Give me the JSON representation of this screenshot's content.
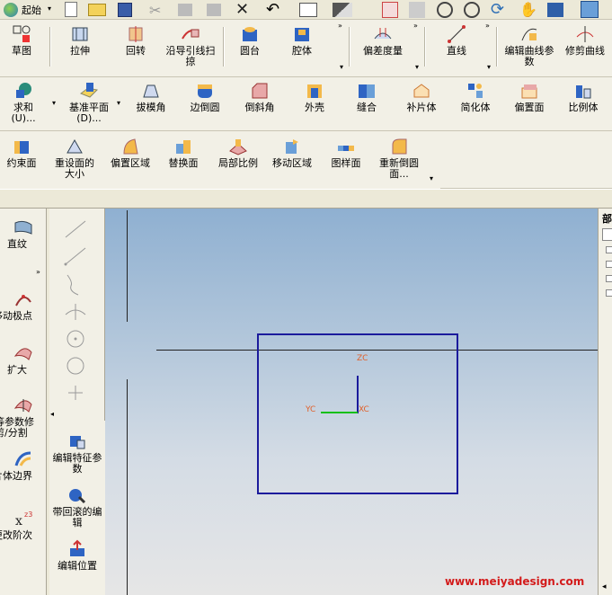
{
  "top_toolbar": {
    "start_label": "起始"
  },
  "row1": [
    {
      "label": "草图"
    },
    {
      "label": "拉伸"
    },
    {
      "label": "回转"
    },
    {
      "label": "沿导引线扫掠"
    },
    {
      "label": "圆台"
    },
    {
      "label": "腔体"
    },
    {
      "label": "偏差度量"
    },
    {
      "label": "直线"
    },
    {
      "label": "编辑曲线参数"
    },
    {
      "label": "修剪曲线"
    }
  ],
  "row2": [
    {
      "label": "求和(U)..."
    },
    {
      "label": "基准平面(D)..."
    },
    {
      "label": "拔模角"
    },
    {
      "label": "边倒圆"
    },
    {
      "label": "倒斜角"
    },
    {
      "label": "外壳"
    },
    {
      "label": "缝合"
    },
    {
      "label": "补片体"
    },
    {
      "label": "简化体"
    },
    {
      "label": "偏置面"
    },
    {
      "label": "比例体"
    }
  ],
  "row3": [
    {
      "label": "约束面"
    },
    {
      "label": "重设面的大小"
    },
    {
      "label": "偏置区域"
    },
    {
      "label": "替换面"
    },
    {
      "label": "局部比例"
    },
    {
      "label": "移动区域"
    },
    {
      "label": "图样面"
    },
    {
      "label": "重新倒圆面..."
    }
  ],
  "left_panel": [
    {
      "label": "直纹"
    },
    {
      "label": "移动极点"
    },
    {
      "label": "扩大"
    },
    {
      "label": "等参数修剪/分割"
    },
    {
      "label": "片体边界"
    },
    {
      "label": "更改阶次"
    }
  ],
  "edit_panel": [
    {
      "label": "编辑特征参数"
    },
    {
      "label": "带回滚的编辑"
    },
    {
      "label": "编辑位置"
    }
  ],
  "right_panel": {
    "title": "部"
  },
  "viewport": {
    "zc": "ZC",
    "yc": "YC",
    "xc": "XC"
  },
  "watermark": "www.meiyadesign.com",
  "colors": {
    "view_box": "#1b1b9c",
    "axis_x": "#16c016",
    "axis_z": "#1b1b9c",
    "axis_label": "#e0602a"
  }
}
